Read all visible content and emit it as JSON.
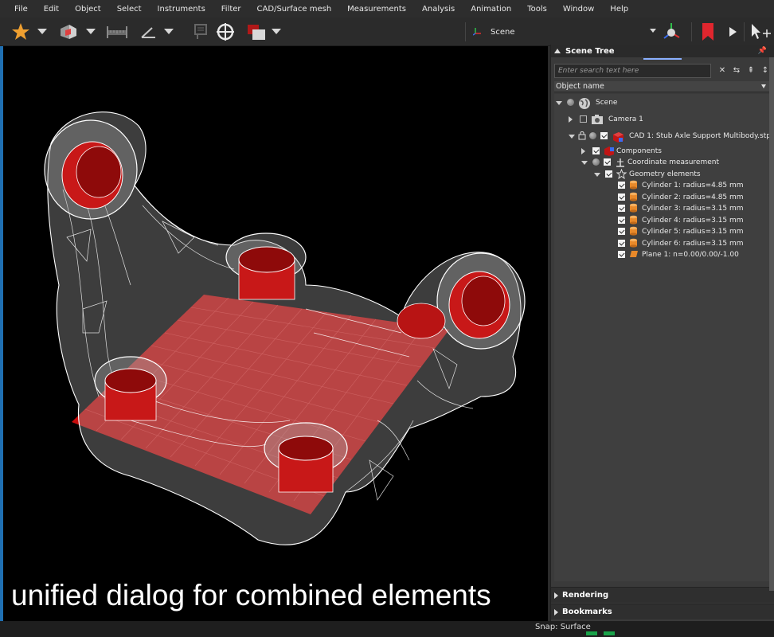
{
  "menu": [
    "File",
    "Edit",
    "Object",
    "Select",
    "Instruments",
    "Filter",
    "CAD/Surface mesh",
    "Measurements",
    "Analysis",
    "Animation",
    "Tools",
    "Window",
    "Help"
  ],
  "toolbar": {
    "scene_selector": "Scene",
    "accent_star": "#f0a030",
    "accent_bookmark": "#e0262e"
  },
  "viewport": {
    "caption": "unified dialog for combined elements",
    "plane_color": "#d01010",
    "mesh_color": "#ffffff"
  },
  "panel": {
    "title": "Scene Tree",
    "search_placeholder": "Enter search text here",
    "column_header": "Object name",
    "tree": [
      {
        "label": "Scene",
        "icon": "globe-icon"
      },
      {
        "label": "Camera 1",
        "icon": "camera-icon"
      },
      {
        "label": "CAD 1: Stub Axle Support Multibody.stp",
        "icon": "cad-icon"
      },
      {
        "label": "Components",
        "icon": "components-icon"
      },
      {
        "label": "Coordinate measurement",
        "icon": "measurement-icon"
      },
      {
        "label": "Geometry elements",
        "icon": "star-icon"
      },
      {
        "label": "Cylinder 1: radius=4.85 mm",
        "icon": "cylinder-icon"
      },
      {
        "label": "Cylinder 2: radius=4.85 mm",
        "icon": "cylinder-icon"
      },
      {
        "label": "Cylinder 3: radius=3.15 mm",
        "icon": "cylinder-icon"
      },
      {
        "label": "Cylinder 4: radius=3.15 mm",
        "icon": "cylinder-icon"
      },
      {
        "label": "Cylinder 5: radius=3.15 mm",
        "icon": "cylinder-icon"
      },
      {
        "label": "Cylinder 6: radius=3.15 mm",
        "icon": "cylinder-icon"
      },
      {
        "label": "Plane 1: n=0.00/0.00/-1.00",
        "icon": "plane-icon"
      }
    ],
    "sections": [
      "Rendering",
      "Bookmarks"
    ]
  },
  "status": {
    "snap": "Snap: Surface",
    "indicator_color": "#19a34a"
  }
}
